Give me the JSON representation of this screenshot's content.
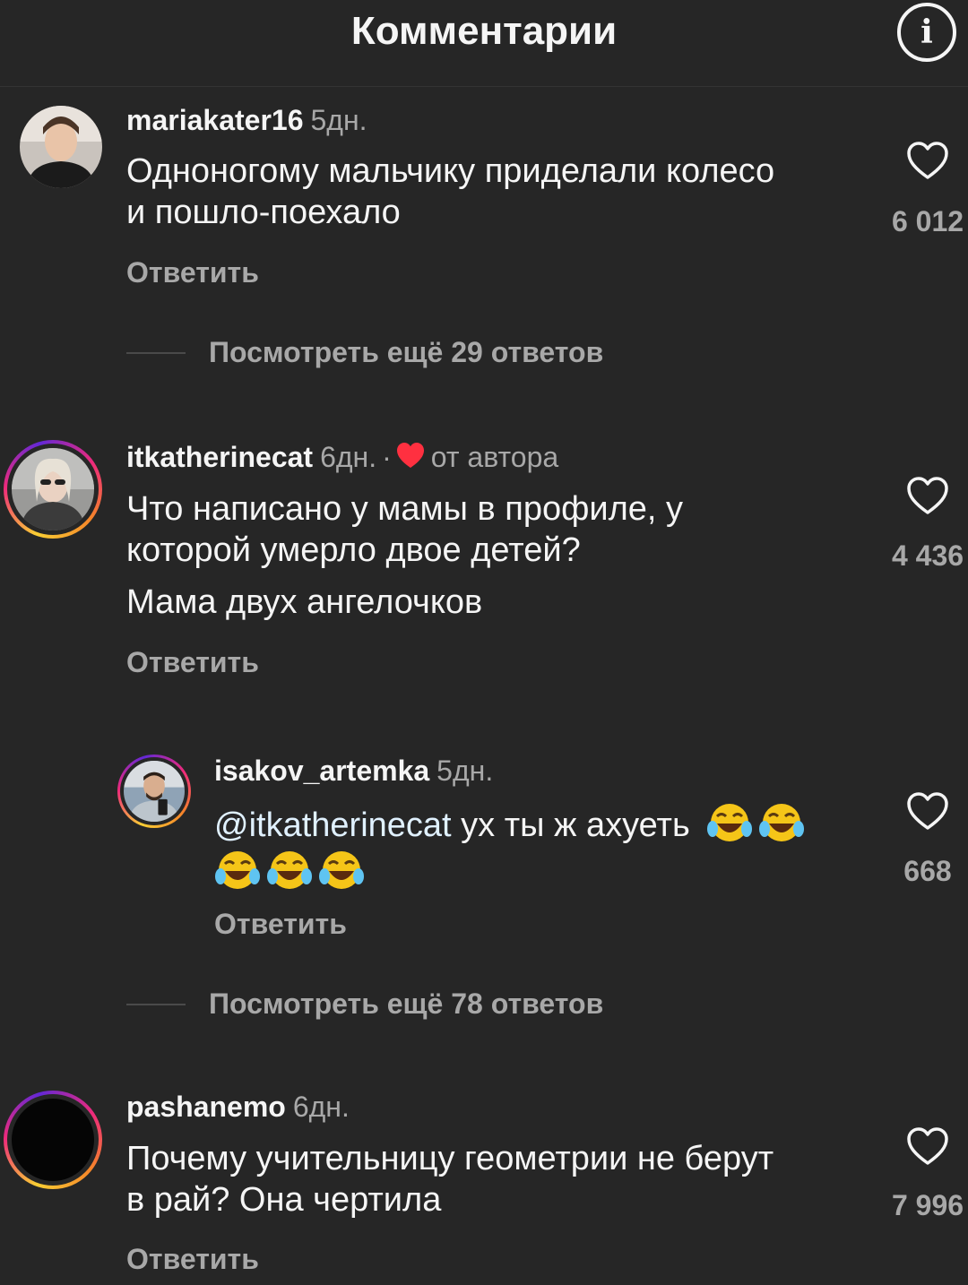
{
  "header": {
    "title": "Комментарии",
    "info_icon": "info-icon",
    "info_glyph": "i"
  },
  "comments": [
    {
      "username": "mariakater16",
      "time": "5дн.",
      "lines": [
        "Одноногому мальчику приделали колесо",
        "и пошло-поехало"
      ],
      "reply": "Ответить",
      "likes": "6 012",
      "view_more": "Посмотреть ещё 29 ответов"
    },
    {
      "username": "itkatherinecat",
      "time": "6дн.",
      "separator": "·",
      "author_note": "от автора",
      "lines": [
        "Что написано у мамы в профиле, у",
        "которой умерло двое детей?",
        "Мама двух ангелочков"
      ],
      "reply": "Ответить",
      "likes": "4 436",
      "replies": [
        {
          "username": "isakov_artemka",
          "time": "5дн.",
          "mention": "@itkatherinecat",
          "text": " ух ты ж ахуеть",
          "reply": "Ответить",
          "likes": "668"
        }
      ],
      "view_more": "Посмотреть ещё 78 ответов"
    },
    {
      "username": "pashanemo",
      "time": "6дн.",
      "lines": [
        "Почему учительницу геометрии не берут",
        "в рай? Она чертила"
      ],
      "reply": "Ответить",
      "likes": "7 996"
    }
  ],
  "colors": {
    "background": "#262626",
    "text": "#f5f5f5",
    "muted": "#a8a8a8",
    "heart_red": "#ff3040"
  }
}
